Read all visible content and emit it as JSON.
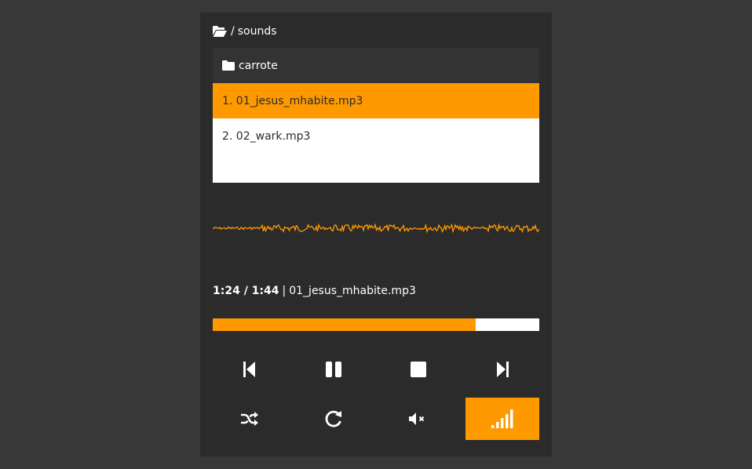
{
  "path": {
    "separator": "/",
    "folder": "sounds"
  },
  "filelist": {
    "folder": "carrote",
    "tracks": [
      {
        "label": "1. 01_jesus_mhabite.mp3"
      },
      {
        "label": "2. 02_wark.mp3"
      }
    ],
    "active_index": 0
  },
  "status": {
    "time": "1:24 / 1:44",
    "separator": "|",
    "track": "01_jesus_mhabite.mp3"
  },
  "progress": {
    "fraction": 0.805
  },
  "controls": {
    "row1": [
      "previous-icon",
      "pause-icon",
      "stop-icon",
      "next-icon"
    ],
    "row2": [
      "shuffle-icon",
      "repeat-icon",
      "mute-icon",
      "volume-bars-icon"
    ],
    "active": "volume-bars-icon"
  },
  "colors": {
    "accent": "#ff9900",
    "panel": "#2b2b2b",
    "background": "#383838",
    "folder_row": "#333333",
    "list_bg": "#ffffff"
  }
}
